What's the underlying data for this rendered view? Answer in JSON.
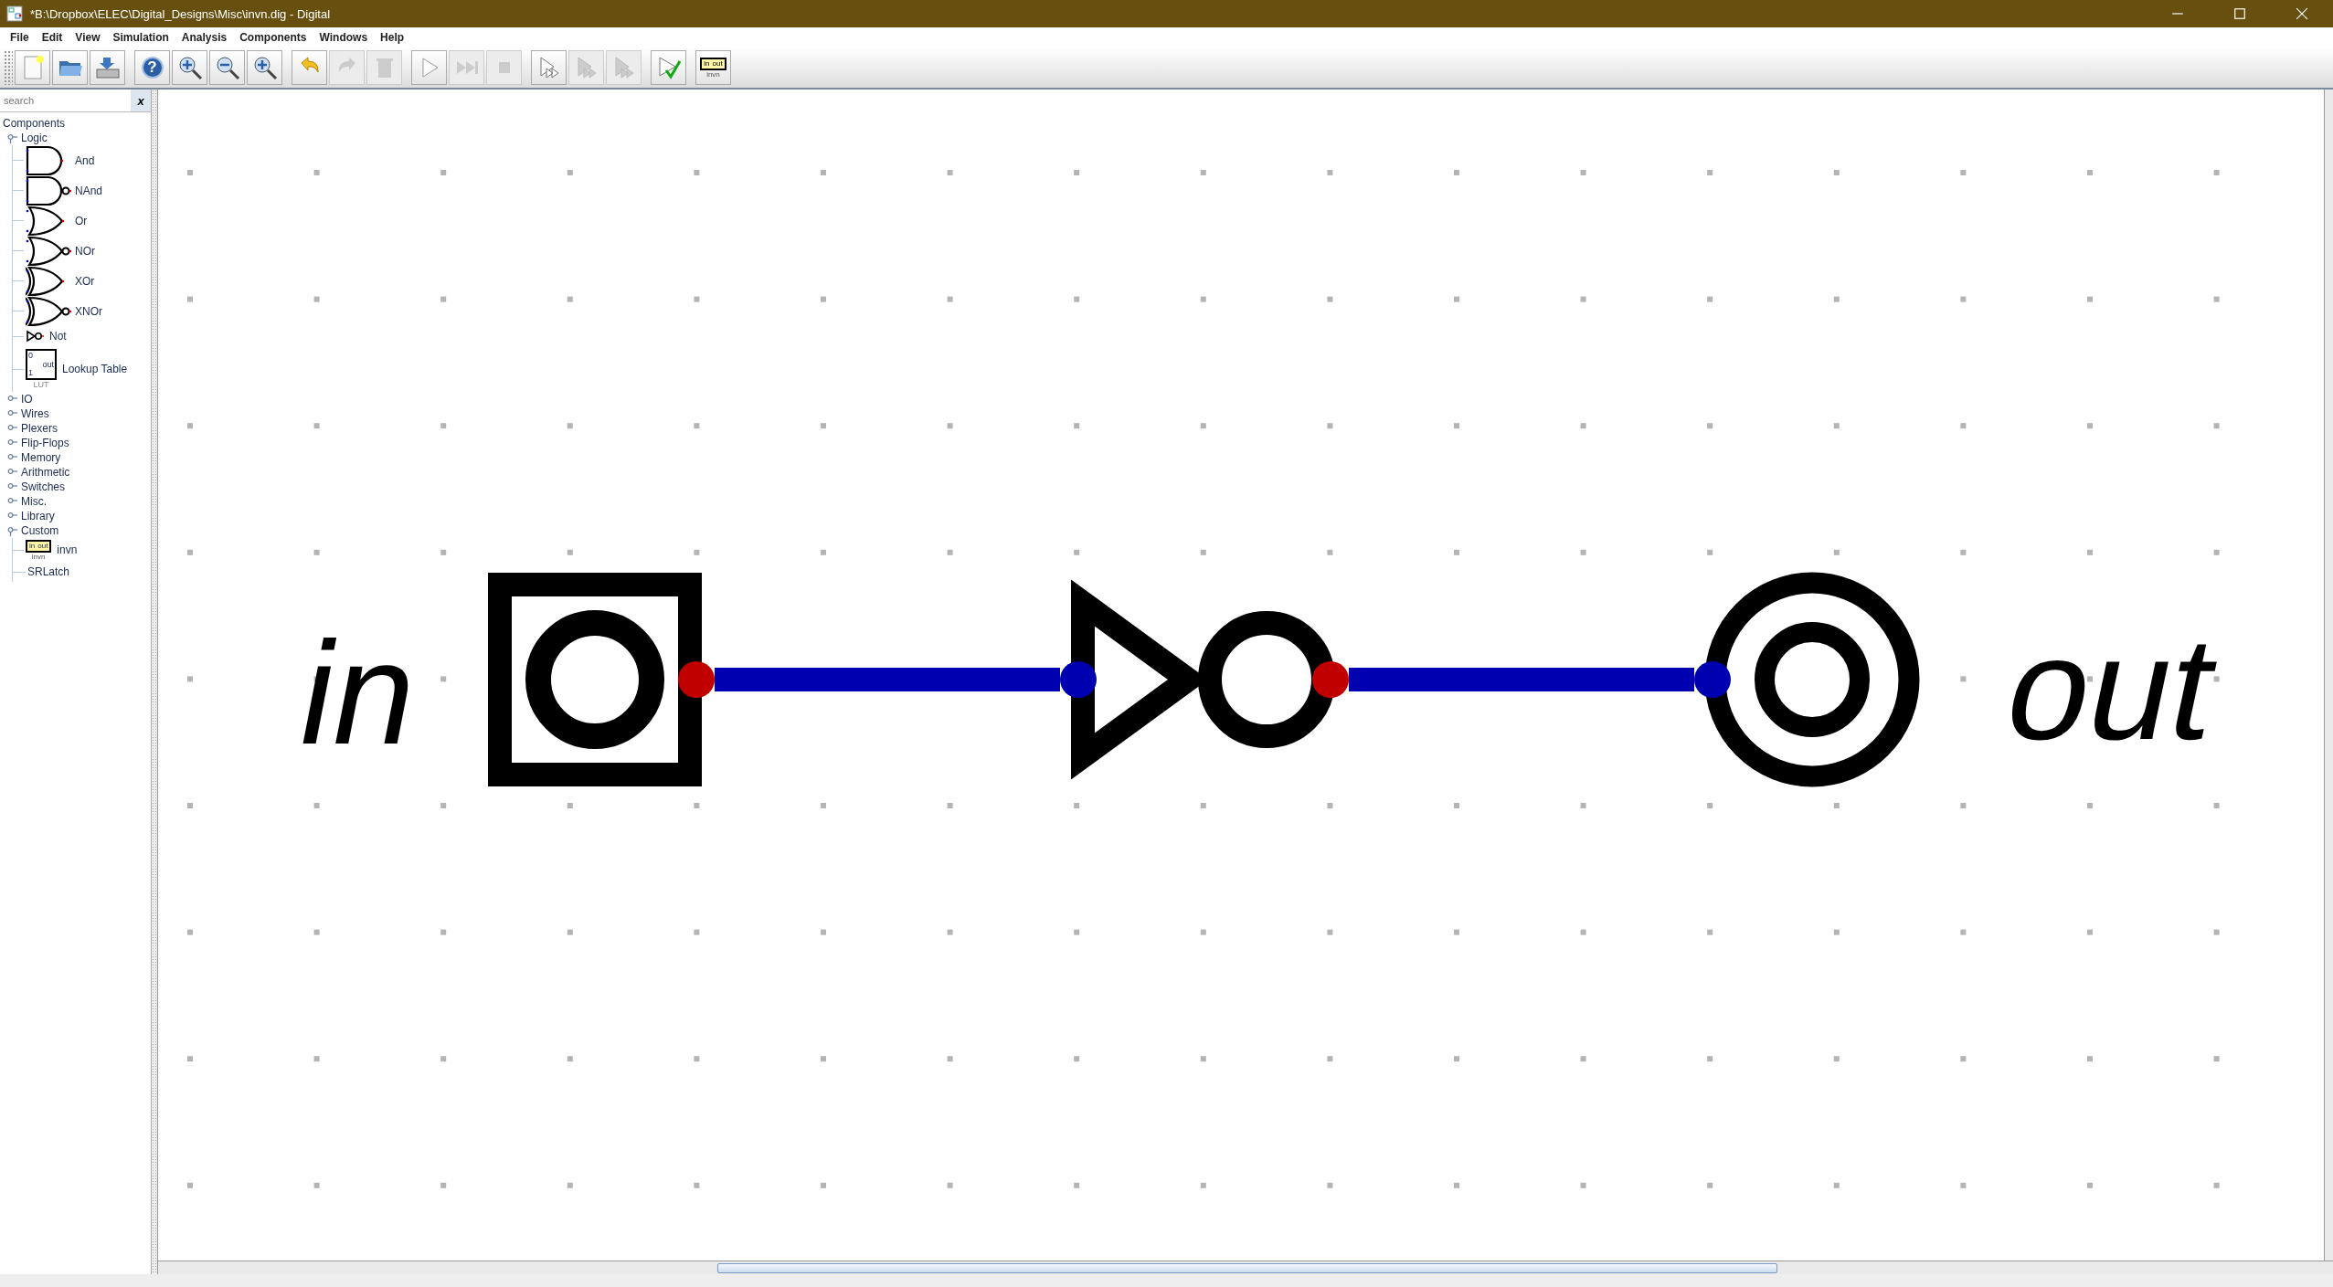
{
  "window": {
    "title": "*B:\\Dropbox\\ELEC\\Digital_Designs\\Misc\\invn.dig - Digital"
  },
  "menu": [
    "File",
    "Edit",
    "View",
    "Simulation",
    "Analysis",
    "Components",
    "Windows",
    "Help"
  ],
  "toolbar": [
    [
      {
        "kind": "new",
        "disabled": false
      },
      {
        "kind": "open",
        "disabled": false
      },
      {
        "kind": "save",
        "disabled": false
      }
    ],
    [
      {
        "kind": "help",
        "glyph": "?",
        "disabled": false
      },
      {
        "kind": "zoom-in",
        "disabled": false
      },
      {
        "kind": "zoom-out",
        "disabled": false
      },
      {
        "kind": "zoom-fit",
        "disabled": false
      }
    ],
    [
      {
        "kind": "undo",
        "disabled": false
      },
      {
        "kind": "redo",
        "disabled": true
      },
      {
        "kind": "delete",
        "disabled": true
      }
    ],
    [
      {
        "kind": "run",
        "disabled": false
      },
      {
        "kind": "step",
        "disabled": true
      },
      {
        "kind": "stop",
        "disabled": true
      }
    ],
    [
      {
        "kind": "micro",
        "disabled": false
      },
      {
        "kind": "micro-step",
        "disabled": true
      },
      {
        "kind": "micro-run",
        "disabled": true
      }
    ],
    [
      {
        "kind": "test",
        "disabled": false
      }
    ],
    [
      {
        "kind": "custom",
        "texts": [
          "in",
          "out",
          "invn"
        ],
        "disabled": false
      }
    ]
  ],
  "sidebar": {
    "search": {
      "placeholder": "search",
      "clear": "x"
    },
    "tree": {
      "label": "Components",
      "children": [
        {
          "label": "Logic",
          "expanded": true,
          "children": [
            {
              "label": "And",
              "kind": "and"
            },
            {
              "label": "NAnd",
              "kind": "nand"
            },
            {
              "label": "Or",
              "kind": "or"
            },
            {
              "label": "NOr",
              "kind": "nor"
            },
            {
              "label": "XOr",
              "kind": "xor"
            },
            {
              "label": "XNOr",
              "kind": "xnor"
            },
            {
              "label": "Not",
              "kind": "not"
            },
            {
              "label": "Lookup Table",
              "kind": "lut",
              "texts": [
                "0",
                "1",
                "out",
                "LUT"
              ]
            }
          ]
        },
        {
          "label": "IO",
          "expanded": false
        },
        {
          "label": "Wires",
          "expanded": false
        },
        {
          "label": "Plexers",
          "expanded": false
        },
        {
          "label": "Flip-Flops",
          "expanded": false
        },
        {
          "label": "Memory",
          "expanded": false
        },
        {
          "label": "Arithmetic",
          "expanded": false
        },
        {
          "label": "Switches",
          "expanded": false
        },
        {
          "label": "Misc.",
          "expanded": false
        },
        {
          "label": "Library",
          "expanded": false
        },
        {
          "label": "Custom",
          "expanded": true,
          "children": [
            {
              "label": "invn",
              "kind": "custom",
              "texts": [
                "in",
                "out",
                "invn"
              ]
            },
            {
              "label": "SRLatch",
              "kind": "none"
            }
          ]
        }
      ]
    }
  },
  "circuit": {
    "elements": [
      {
        "kind": "input",
        "label": "in"
      },
      {
        "kind": "not"
      },
      {
        "kind": "output",
        "label": "out"
      }
    ]
  }
}
